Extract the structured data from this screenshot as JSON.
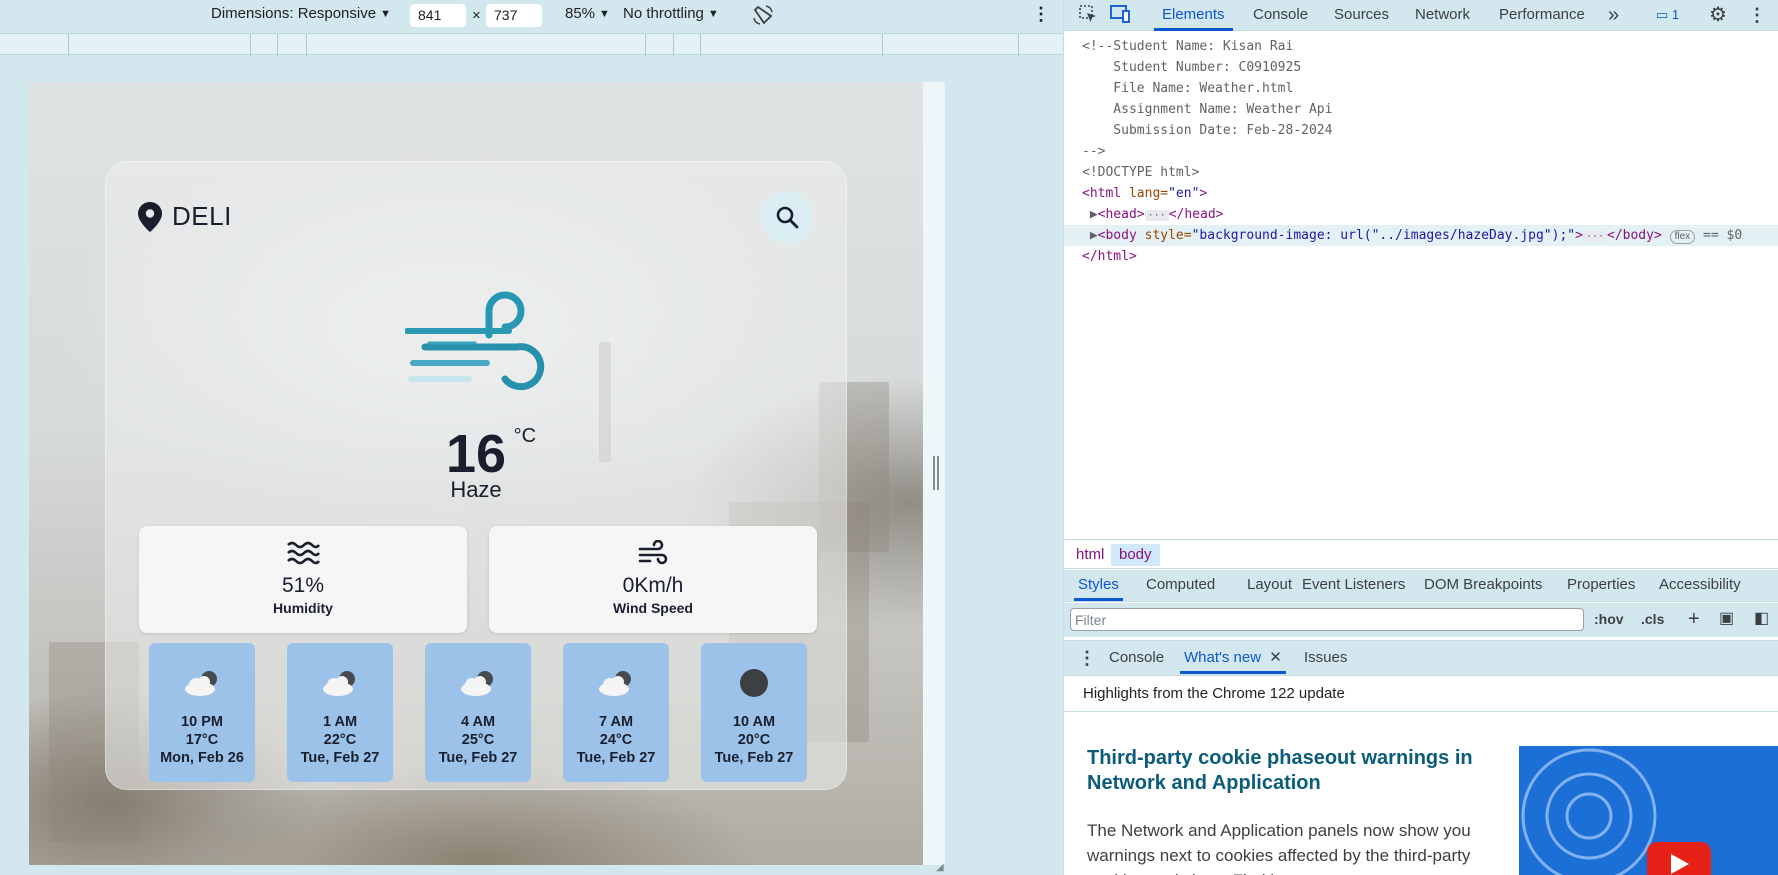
{
  "device_toolbar": {
    "dimensions_label": "Dimensions: Responsive",
    "width_value": "841",
    "times": "×",
    "height_value": "737",
    "zoom_label": "85%",
    "throttle_label": "No throttling"
  },
  "weather_app": {
    "location": "DELI",
    "temperature": "16",
    "temperature_unit": "°C",
    "condition": "Haze",
    "humidity_value": "51%",
    "humidity_label": "Humidity",
    "wind_value": "0Km/h",
    "wind_label": "Wind Speed",
    "forecast": [
      {
        "time": "10 PM",
        "temp": "17°C",
        "date": "Mon, Feb 26",
        "icon": "cloud-night-icon"
      },
      {
        "time": "1 AM",
        "temp": "22°C",
        "date": "Tue, Feb 27",
        "icon": "cloud-night-icon"
      },
      {
        "time": "4 AM",
        "temp": "25°C",
        "date": "Tue, Feb 27",
        "icon": "cloud-night-icon"
      },
      {
        "time": "7 AM",
        "temp": "24°C",
        "date": "Tue, Feb 27",
        "icon": "cloud-night-icon"
      },
      {
        "time": "10 AM",
        "temp": "20°C",
        "date": "Tue, Feb 27",
        "icon": "dark-circle-icon"
      }
    ]
  },
  "devtools": {
    "tabs": [
      "Elements",
      "Console",
      "Sources",
      "Network",
      "Performance"
    ],
    "more_tabs": "»",
    "issues_count": "1",
    "dom_lines": {
      "c1": "<!--Student Name: Kisan Rai",
      "c2": "    Student Number: C0910925",
      "c3": "    File Name: Weather.html",
      "c4": "    Assignment Name: Weather Api",
      "c5": "    Submission Date: Feb-28-2024",
      "c6": "-->",
      "doctype": "<!DOCTYPE html>",
      "html_open_tag": "<html",
      "html_attr": " lang=",
      "html_attr_val": "\"en\"",
      "html_close_br": ">",
      "head_open": "<head>",
      "head_close": "</head>",
      "body_open": "<body",
      "body_attr": " style=",
      "body_attr_val": "\"background-image: url(\"../images/hazeDay.jpg\");\"",
      "body_gt": ">",
      "body_close": "</body>",
      "flex_pill": "flex",
      "dollar": "== $0",
      "html_close": "</html>"
    },
    "breadcrumbs": [
      "html",
      "body"
    ],
    "sub_tabs": [
      "Styles",
      "Computed",
      "Layout",
      "Event Listeners",
      "DOM Breakpoints",
      "Properties",
      "Accessibility"
    ],
    "filter_placeholder": "Filter",
    "hov": ":hov",
    "cls": ".cls",
    "drawer_tabs": [
      "Console",
      "What's new",
      "Issues"
    ],
    "whats_new_heading": "Highlights from the Chrome 122 update",
    "article_title": "Third-party cookie phaseout warnings in Network and Application",
    "article_body": "The Network and Application panels now show you warnings next to cookies affected by the third-party cookie restrictions. Find issues..."
  }
}
